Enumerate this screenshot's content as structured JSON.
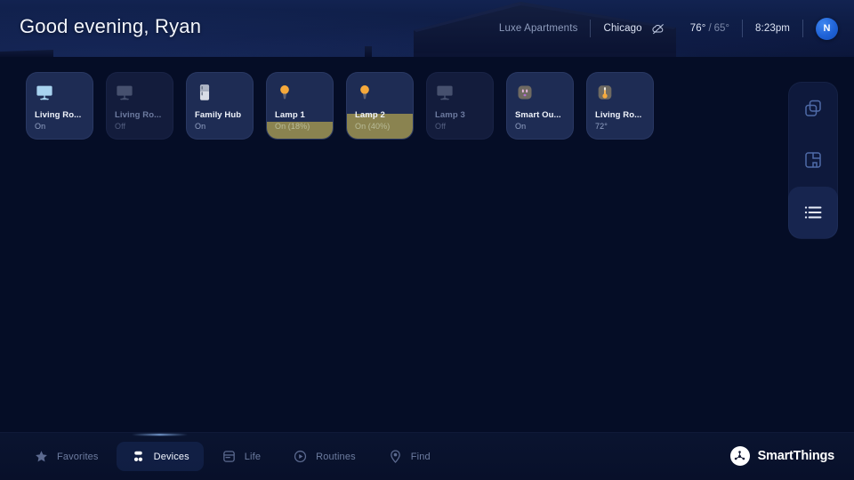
{
  "header": {
    "greeting": "Good evening, Ryan",
    "home_name": "Luxe Apartments",
    "city": "Chicago",
    "weather_icon": "cloud-night-icon",
    "temp_high": "76°",
    "temp_separator": "/",
    "temp_low": "65°",
    "time": "8:23pm",
    "avatar_initial": "N"
  },
  "devices": [
    {
      "label": "Living Ro...",
      "status": "On",
      "icon": "tv-icon",
      "state": "on",
      "fill_percent": 0
    },
    {
      "label": "Living Ro...",
      "status": "Off",
      "icon": "tv-icon",
      "state": "off",
      "fill_percent": 0
    },
    {
      "label": "Family Hub",
      "status": "On",
      "icon": "refrigerator-icon",
      "state": "on",
      "fill_percent": 0
    },
    {
      "label": "Lamp 1",
      "status": "On (18%)",
      "icon": "lightbulb-icon",
      "state": "dim",
      "fill_percent": 26
    },
    {
      "label": "Lamp 2",
      "status": "On (40%)",
      "icon": "lightbulb-icon",
      "state": "dim",
      "fill_percent": 38
    },
    {
      "label": "Lamp 3",
      "status": "Off",
      "icon": "tv-icon",
      "state": "off",
      "fill_percent": 0
    },
    {
      "label": "Smart Ou...",
      "status": "On",
      "icon": "outlet-icon",
      "state": "on",
      "fill_percent": 0
    },
    {
      "label": "Living Ro...",
      "status": "72°",
      "icon": "thermostat-icon",
      "state": "on",
      "fill_percent": 0
    }
  ],
  "view_switcher": {
    "buttons": [
      {
        "icon": "cards-view-icon",
        "active": false
      },
      {
        "icon": "floorplan-view-icon",
        "active": false
      },
      {
        "icon": "list-view-icon",
        "active": true
      }
    ]
  },
  "bottom_nav": {
    "items": [
      {
        "label": "Favorites",
        "icon": "star-icon",
        "active": false
      },
      {
        "label": "Devices",
        "icon": "devices-icon",
        "active": true
      },
      {
        "label": "Life",
        "icon": "life-icon",
        "active": false
      },
      {
        "label": "Routines",
        "icon": "routines-icon",
        "active": false
      },
      {
        "label": "Find",
        "icon": "find-pin-icon",
        "active": false
      }
    ]
  },
  "brand": {
    "name": "SmartThings",
    "icon": "smartthings-logo-icon"
  },
  "colors": {
    "background": "#050d26",
    "header_top": "#122351",
    "card_on": "#1e2c54",
    "card_off": "#131c3c",
    "dim_fill": "#8a8350",
    "accent_blue": "#1f62d6",
    "lamp_amber": "#f6a93b"
  }
}
